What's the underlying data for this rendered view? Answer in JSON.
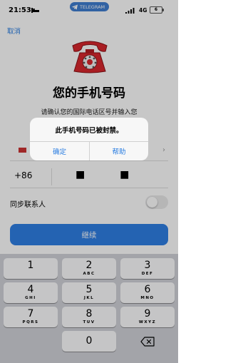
{
  "status_bar": {
    "time": "21:53",
    "telegram_pill": "TELEGRAM",
    "network": "4G",
    "battery": "6"
  },
  "header": {
    "cancel_label": "取消"
  },
  "main": {
    "title": "您的手机号码",
    "subtitle": "请确认您的国际电话区号并输入您",
    "country_code": "+86",
    "phone_value": "■ ■",
    "sync_contacts_label": "同步联系人",
    "sync_contacts_on": false,
    "continue_label": "继续"
  },
  "alert": {
    "message": "此手机号码已被封禁。",
    "ok_label": "确定",
    "help_label": "帮助"
  },
  "keypad": {
    "keys": [
      {
        "digit": "1",
        "letters": ""
      },
      {
        "digit": "2",
        "letters": "ABC"
      },
      {
        "digit": "3",
        "letters": "DEF"
      },
      {
        "digit": "4",
        "letters": "GHI"
      },
      {
        "digit": "5",
        "letters": "JKL"
      },
      {
        "digit": "6",
        "letters": "MNO"
      },
      {
        "digit": "7",
        "letters": "PQRS"
      },
      {
        "digit": "8",
        "letters": "TUV"
      },
      {
        "digit": "9",
        "letters": "WXYZ"
      },
      {
        "digit": "0",
        "letters": ""
      }
    ]
  },
  "colors": {
    "accent": "#2f7fe4",
    "link": "#2a7de1",
    "telephone_red": "#d9272e",
    "keypad_bg": "#d1d3d9"
  }
}
